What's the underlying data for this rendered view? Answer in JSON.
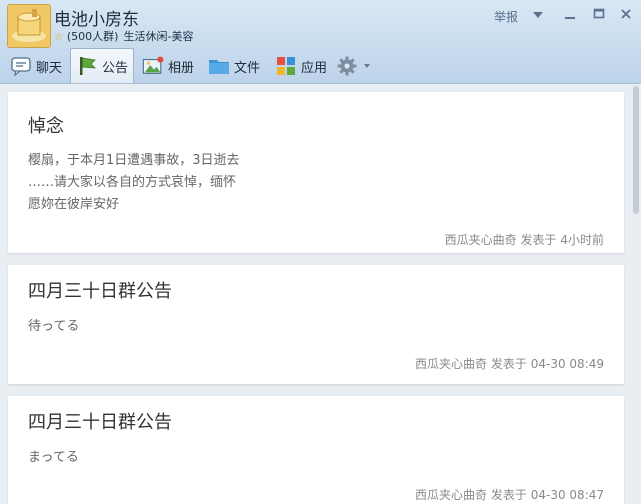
{
  "header": {
    "group_name": "电池小房东",
    "member_count": "(500人群)",
    "category": "生活休闲-美容",
    "report": "举报"
  },
  "tabs": [
    {
      "label": "聊天",
      "icon": "chat-icon"
    },
    {
      "label": "公告",
      "icon": "flag-icon"
    },
    {
      "label": "相册",
      "icon": "photo-album-icon"
    },
    {
      "label": "文件",
      "icon": "folder-icon"
    },
    {
      "label": "应用",
      "icon": "apps-icon"
    },
    {
      "label": "",
      "icon": "gear-icon"
    }
  ],
  "active_tab": "公告",
  "announcements": [
    {
      "title": "悼念",
      "lines": [
        "樱扇，于本月1日遭遇事故，3日逝去",
        "……请大家以各自的方式哀悼，缅怀",
        "愿妳在彼岸安好"
      ],
      "author": "西瓜夹心曲奇",
      "posted_label": "发表于",
      "time": "4小时前"
    },
    {
      "title": "四月三十日群公告",
      "lines": [
        "待ってる"
      ],
      "author": "西瓜夹心曲奇",
      "posted_label": "发表于",
      "time": "04-30 08:49"
    },
    {
      "title": "四月三十日群公告",
      "lines": [
        "まってる"
      ],
      "author": "西瓜夹心曲奇",
      "posted_label": "发表于",
      "time": "04-30 08:47"
    }
  ],
  "colors": {
    "header_bg": "#c9dcee",
    "content_bg": "#e9eef3",
    "card_bg": "#ffffff",
    "title_text": "#333333",
    "body_text": "#666666",
    "footer_text": "#8a8a8a"
  }
}
